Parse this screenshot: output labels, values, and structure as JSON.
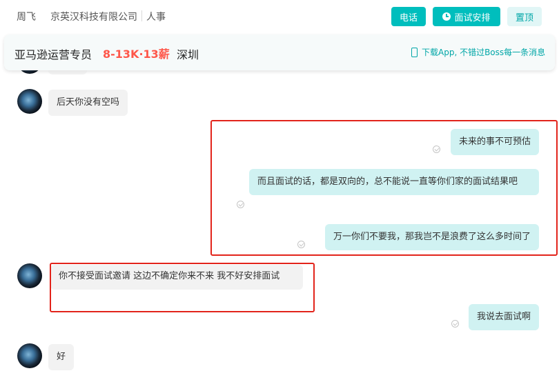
{
  "header": {
    "name": "周飞",
    "company": "京英汉科技有限公司",
    "role": "人事",
    "call_label": "电话",
    "interview_label": "面试安排",
    "pin_label": "置顶"
  },
  "job": {
    "title": "亚马逊运营专员",
    "salary": "8-13K·13薪",
    "city": "深圳",
    "download_text": "下载App, 不错过Boss每一条消息"
  },
  "messages": [
    {
      "from": "them",
      "text": "后天你没有空吗"
    },
    {
      "from": "me",
      "text": "未来的事不可预估"
    },
    {
      "from": "me",
      "text": "而且面试的话，都是双向的，总不能说一直等你们家的面试结果吧"
    },
    {
      "from": "me",
      "text": "万一你们不要我，那我岂不是浪费了这么多时间了"
    },
    {
      "from": "them",
      "text": "你不接受面试邀请 这边不确定你来不来 我不好安排面试"
    },
    {
      "from": "me",
      "text": "我说去面试啊"
    },
    {
      "from": "them",
      "text": "好"
    }
  ],
  "colors": {
    "accent": "#00bebd",
    "salary": "#fe574a",
    "highlight": "#e2231a",
    "bubble_out": "#d0f2f2",
    "bubble_in": "#f2f2f2"
  }
}
